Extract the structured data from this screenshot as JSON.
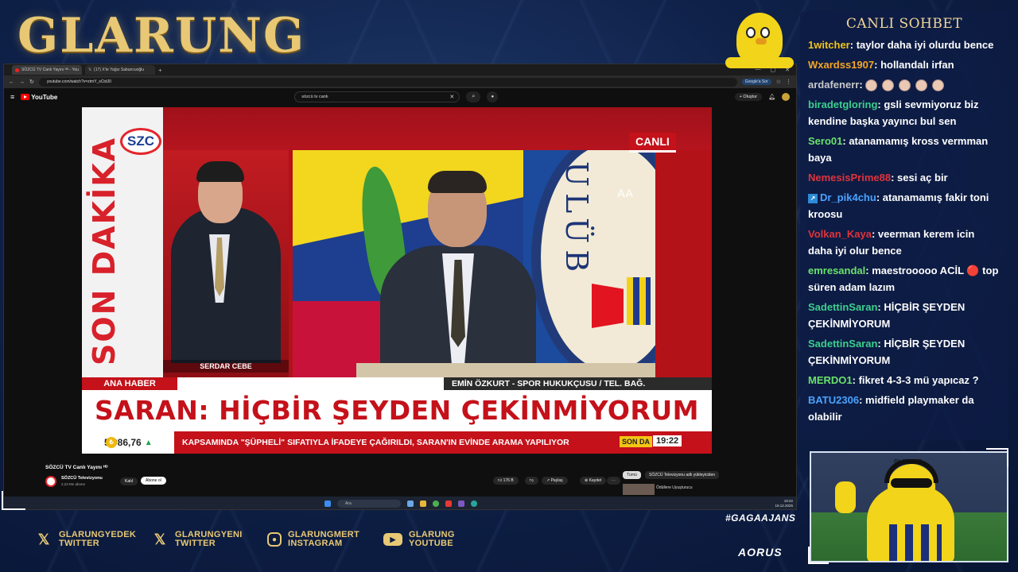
{
  "overlay": {
    "logo": "GLARUNG",
    "hashtag": "#GAGAAJANS",
    "sponsor": "AORUS",
    "socials": [
      {
        "icon": "x-icon",
        "line1": "GLARUNGYEDEK",
        "line2": "TWITTER"
      },
      {
        "icon": "x-icon",
        "line1": "GLARUNGYENI",
        "line2": "TWITTER"
      },
      {
        "icon": "instagram-icon",
        "line1": "GLARUNGMERT",
        "line2": "INSTAGRAM"
      },
      {
        "icon": "youtube-icon",
        "line1": "GLARUNG",
        "line2": "YOUTUBE"
      }
    ],
    "webcam_brand": "GLARUNG"
  },
  "browser": {
    "tabs": [
      {
        "label": "SÖZCÜ TV Canlı Yayını ᴴᴰ - You"
      },
      {
        "label": "(17) X'te Yağız Sabuncuoğlu"
      }
    ],
    "url": "youtube.com/watch?v=ztmY_sCtdJ0",
    "google_pill": "Google'a Sor"
  },
  "youtube": {
    "logo": "YouTube",
    "search_value": "sözcü tv canlı",
    "create_label": "Oluştur",
    "video_title": "SÖZCÜ TV Canlı Yayını ᴴᴰ",
    "channel_name": "SÖZCÜ Televizyonu",
    "channel_subs": "2,23 Mn abone",
    "join_label": "Katıl",
    "subscribe_label": "Abone ol",
    "likes": "176 B",
    "share_label": "Paylaş",
    "save_label": "Kaydet",
    "chips": [
      "Tümü",
      "SÖZCÜ Televizyonu adlı yükleyiciden"
    ],
    "rec_title": "Ödüllere Uyuşturucu"
  },
  "broadcast": {
    "channel_logo": "SZC",
    "vertical_banner": "SON DAKİKA",
    "live_badge": "CANLI",
    "anchor_name": "SERDAR CEBE",
    "program": "ANA HABER",
    "guest_label": "EMİN ÖZKURT - SPOR HUKUKÇUSU / TEL. BAĞ.",
    "headline": "SARAN: HİÇBİR ŞEYDEN ÇEKİNMİYORUM",
    "ticker_price": "5.986,76",
    "ticker_text": "KAPSAMINDA \"ŞÜPHELİ\" SIFATIYLA İFADEYE ÇAĞIRILDI, SARAN'IN EVİNDE ARAMA YAPILIYOR",
    "ticker_tag": "SON DA",
    "clock": "19:22",
    "crest_text": "ULÜB",
    "watermark": "AA"
  },
  "taskbar": {
    "search_label": "Ara",
    "time": "19:22",
    "date": "19.12.2025"
  },
  "chat": {
    "title": "CANLI SOHBET",
    "messages": [
      {
        "user": "1witcher",
        "color": "#f0c419",
        "text": ": taylor daha iyi olurdu bence"
      },
      {
        "user": "Wxardss1907",
        "color": "#f5a623",
        "text": ": hollandalı irfan"
      },
      {
        "user": "ardafenerr",
        "color": "#c9c9c9",
        "text": ":",
        "emotes": 5
      },
      {
        "user": "biradetgloring",
        "color": "#3ccf8e",
        "text": ": gsli sevmiyoruz biz kendine başka yayıncı bul sen"
      },
      {
        "user": "Sero01",
        "color": "#6be26b",
        "text": ": atanamamış kross vermman baya"
      },
      {
        "user": "NemesisPrime88",
        "color": "#e0333c",
        "text": ": sesi aç bir"
      },
      {
        "user": "Dr_pik4chu",
        "color": "#4aa3ff",
        "text": ": atanamamış fakir toni kroosu",
        "badge": true
      },
      {
        "user": "Volkan_Kaya",
        "color": "#e0333c",
        "text": ": veerman kerem icin daha iyi olur bence"
      },
      {
        "user": "emresandal",
        "color": "#6be26b",
        "text": ": maestrooooo ACİL 🔴 top süren adam lazım"
      },
      {
        "user": "SadettinSaran",
        "color": "#3ccf8e",
        "text": ": HİÇBİR ŞEYDEN ÇEKİNMİYORUM"
      },
      {
        "user": "SadettinSaran",
        "color": "#3ccf8e",
        "text": ": HİÇBİR ŞEYDEN ÇEKİNMİYORUM"
      },
      {
        "user": "MERDO1",
        "color": "#6be26b",
        "text": ": fikret 4-3-3 mü yapıcaz ?"
      },
      {
        "user": "BATU2306",
        "color": "#4aa3ff",
        "text": ": midfield playmaker da olabilir"
      }
    ]
  },
  "colors": {
    "accent_gold": "#e8c874",
    "broadcast_red": "#c4111a",
    "chat_bg": "#0e1c44"
  }
}
